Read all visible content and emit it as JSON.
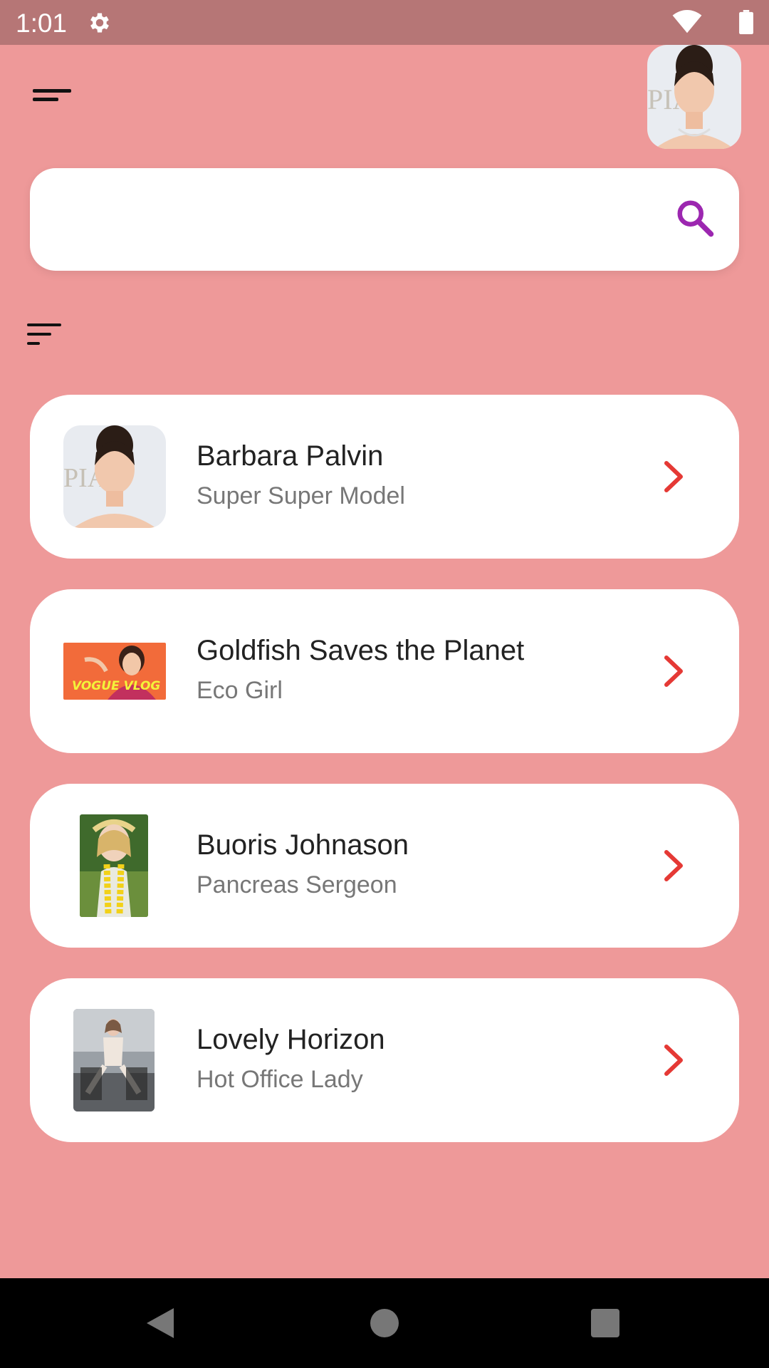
{
  "status_bar": {
    "time": "1:01",
    "icons": [
      "gear-icon",
      "wifi-icon",
      "battery-icon"
    ]
  },
  "header": {
    "menu_icon": "menu-icon",
    "avatar": "profile-avatar"
  },
  "search": {
    "value": "",
    "placeholder": "",
    "icon": "search-icon",
    "icon_color": "#9c27b0"
  },
  "list": {
    "sort_icon": "sort-icon",
    "items": [
      {
        "title": "Barbara Palvin",
        "subtitle": "Super Super Model",
        "icon": "chevron-right-icon"
      },
      {
        "title": "Goldfish Saves the Planet",
        "subtitle": "Eco Girl",
        "icon": "chevron-right-icon",
        "thumb_text": "VOGUE VLOG"
      },
      {
        "title": "Buoris Johnason",
        "subtitle": "Pancreas Sergeon",
        "icon": "chevron-right-icon"
      },
      {
        "title": "Lovely Horizon",
        "subtitle": "Hot Office Lady",
        "icon": "chevron-right-icon"
      }
    ]
  },
  "colors": {
    "background": "#ee9999",
    "status_bar": "#b67676",
    "card": "#ffffff",
    "chevron": "#e53935",
    "title": "#222222",
    "subtitle": "#777777"
  },
  "nav_bar": {
    "icons": [
      "back-icon",
      "home-icon",
      "recents-icon"
    ]
  }
}
